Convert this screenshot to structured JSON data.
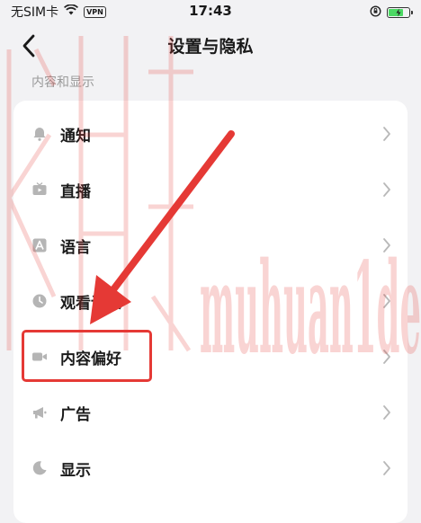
{
  "status_bar": {
    "carrier": "无SIM卡",
    "vpn": "VPN",
    "time": "17:43",
    "battery_level": 0.8,
    "battery_color": "#4cd964"
  },
  "nav": {
    "title": "设置与隐私",
    "back_icon": "chevron-left-icon"
  },
  "section": {
    "header": "内容和显示"
  },
  "menu_items": [
    {
      "label": "通知",
      "icon": "bell-icon"
    },
    {
      "label": "直播",
      "icon": "tv-icon"
    },
    {
      "label": "语言",
      "icon": "language-icon"
    },
    {
      "label": "观看记录",
      "icon": "clock-icon"
    },
    {
      "label": "内容偏好",
      "icon": "video-camera-icon"
    },
    {
      "label": "广告",
      "icon": "megaphone-icon"
    },
    {
      "label": "显示",
      "icon": "moon-icon"
    }
  ],
  "annotation": {
    "highlight_color": "#e53935",
    "highlighted_item": "内容偏好"
  },
  "watermark": {
    "text": "muhuan1de"
  }
}
